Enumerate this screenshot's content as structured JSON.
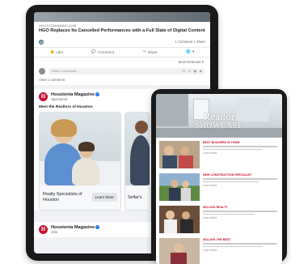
{
  "facebook": {
    "link_post": {
      "domain": "HOUSTONIAMAG.COM",
      "title": "HGO Replaces Its Cancelled Performances with a Full Slate of Digital Content",
      "comment_share_count": "1 Comment 1 Share",
      "reaction_icon": "like-icon",
      "actions": [
        {
          "label": "Like",
          "icon": "thumbs-up-icon"
        },
        {
          "label": "Comment",
          "icon": "speech-bubble-icon"
        },
        {
          "label": "Share",
          "icon": "share-arrow-icon"
        }
      ],
      "sort_label": "Most Relevant",
      "comment_placeholder": "Write a comment...",
      "view_comments": "View 1 comment"
    },
    "sponsored_post": {
      "page_name": "Houstonia Magazine",
      "sponsored_label": "Sponsored",
      "text": "Meet the Realtors of Houston",
      "cards": [
        {
          "title": "Realty Specialists of Houston",
          "button": "Learn More"
        },
        {
          "title": "Sellar's"
        }
      ]
    },
    "next_post": {
      "page_name": "Houstonia Magazine",
      "time": "10m"
    }
  },
  "showcase": {
    "title": "Realtor",
    "subtitle": "SHOWCASE",
    "listings": [
      {
        "title": "BEST BUILDERS IN TOWN",
        "more": "Learn More"
      },
      {
        "title": "NEW CONSTRUCTION SPECIALIST",
        "more": "Learn More"
      },
      {
        "title": "SELLING REALTY",
        "more": "Learn More"
      },
      {
        "title": "SELLING THE BEST",
        "more": "Learn More"
      }
    ]
  },
  "colors": {
    "facebook_blue": "#1877f2",
    "brand_red": "#c8102e",
    "device_frame": "#1a1a1a"
  }
}
